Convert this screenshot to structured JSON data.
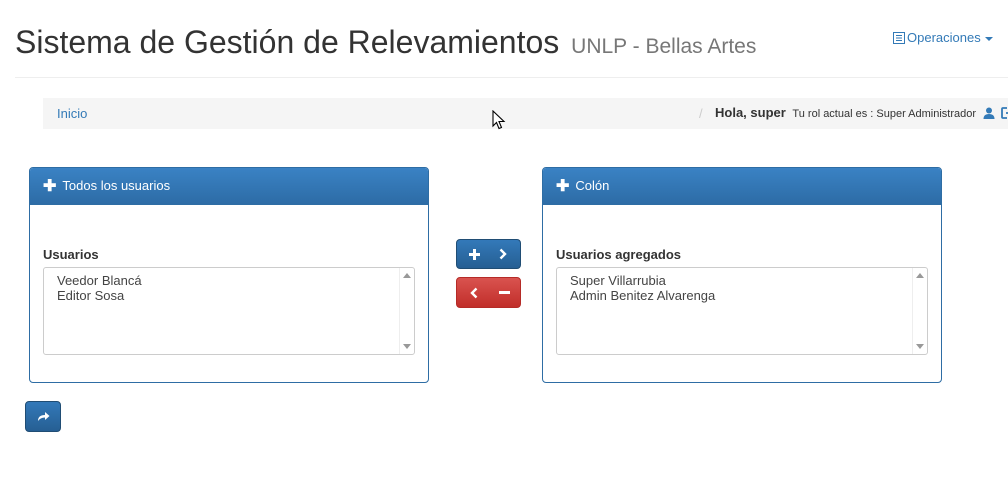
{
  "header": {
    "title": "Sistema de Gestión de Relevamientos",
    "subtitle": "UNLP - Bellas Artes",
    "operations_label": "Operaciones"
  },
  "breadcrumb": {
    "home": "Inicio",
    "separator": "/",
    "greeting": "Hola, super",
    "role_text": "Tu rol actual es : Super Administrador"
  },
  "left_panel": {
    "heading": "Todos los usuarios",
    "list_label": "Usuarios",
    "items": [
      "Veedor Blancá",
      "Editor Sosa"
    ]
  },
  "right_panel": {
    "heading": "Colón",
    "list_label": "Usuarios agregados",
    "items": [
      "Super Villarrubia",
      "Admin Benitez Alvarenga"
    ]
  },
  "icons": {
    "operations": "list-icon",
    "user": "user-icon",
    "logout": "logout-icon",
    "add": "plus-icon",
    "move_right": "chevron-right-icon",
    "move_left": "chevron-left-icon",
    "remove": "minus-icon",
    "submit": "share-arrow-icon"
  },
  "colors": {
    "primary": "#337ab7",
    "danger": "#d9534f"
  }
}
